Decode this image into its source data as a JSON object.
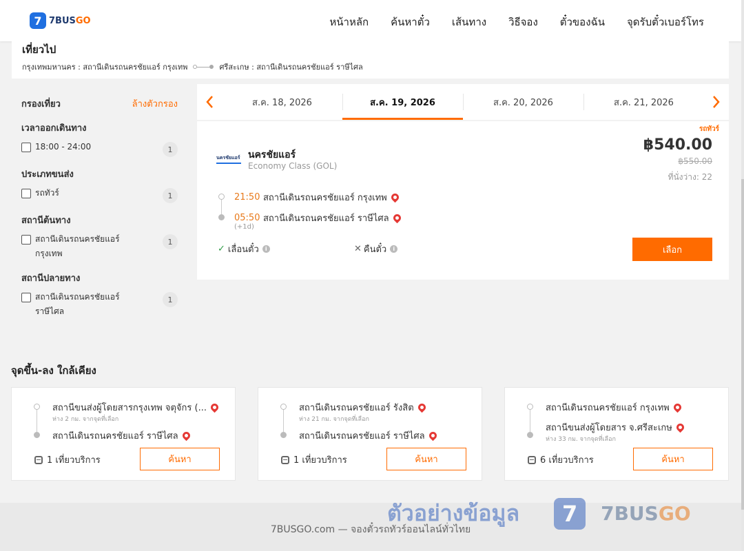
{
  "header": {
    "logo_number": "7",
    "logo_text_1": "7BUS",
    "logo_text_2": "GO",
    "nav": [
      "หน้าหลัก",
      "ค้นหาตั๋ว",
      "เส้นทาง",
      "วิธีจอง",
      "ตั๋วของฉัน",
      "จุดรับตั๋วเบอร์โทร"
    ]
  },
  "route": {
    "title": "เที่ยวไป",
    "from": "กรุงเทพมหานคร : สถานีเดินรถนครชัยแอร์ กรุงเทพ",
    "to": "ศรีสะเกษ : สถานีเดินรถนครชัยแอร์ ราษีไศล"
  },
  "filter": {
    "title": "กรองเที่ยว",
    "clear": "ล้างตัวกรอง",
    "groups": [
      {
        "title": "เวลาออกเดินทาง",
        "options": [
          {
            "label": "18:00 - 24:00",
            "count": "1"
          }
        ]
      },
      {
        "title": "ประเภทขนส่ง",
        "options": [
          {
            "label": "รถทัวร์",
            "count": "1"
          }
        ]
      },
      {
        "title": "สถานีต้นทาง",
        "options": [
          {
            "label": "สถานีเดินรถนครชัยแอร์ กรุงเทพ",
            "count": "1"
          }
        ]
      },
      {
        "title": "สถานีปลายทาง",
        "options": [
          {
            "label": "สถานีเดินรถนครชัยแอร์ ราษีไศล",
            "count": "1"
          }
        ]
      }
    ]
  },
  "dates": {
    "prev_arrow": "‹",
    "next_arrow": "›",
    "tabs": [
      "ส.ค. 18, 2026",
      "ส.ค. 19, 2026",
      "ส.ค. 20, 2026",
      "ส.ค. 21, 2026"
    ],
    "active_index": 1
  },
  "trip": {
    "tag": "รถทัวร์",
    "operator_logo": "นครชัยแอร์",
    "operator": "นครชัยแอร์",
    "class": "Economy Class (GOL)",
    "price": "฿540.00",
    "old_price": "฿550.00",
    "seats": "ที่นั่งว่าง: 22",
    "depart_time": "21:50",
    "depart_station": "สถานีเดินรถนครชัยแอร์ กรุงเทพ",
    "arrive_time": "05:50",
    "arrive_station": "สถานีเดินรถนครชัยแอร์ ราษีไศล",
    "plus_day": "(+1d)",
    "reschedule": "เลื่อนตั๋ว",
    "refund": "คืนตั๋ว",
    "choose": "เลือก"
  },
  "nearby": {
    "title": "จุดขึ้น-ลง ใกล้เคียง",
    "cards": [
      {
        "from": "สถานีขนส่งผู้โดยสารกรุงเทพ จตุจักร (...",
        "from_note": "ห่าง 2 กม. จากจุดที่เลือก",
        "to": "สถานีเดินรถนครชัยแอร์ ราษีไศล",
        "to_note": "",
        "trips": "1 เที่ยวบริการ",
        "search": "ค้นหา"
      },
      {
        "from": "สถานีเดินรถนครชัยแอร์ รังสิต",
        "from_note": "ห่าง 21 กม. จากจุดที่เลือก",
        "to": "สถานีเดินรถนครชัยแอร์ ราษีไศล",
        "to_note": "",
        "trips": "1 เที่ยวบริการ",
        "search": "ค้นหา"
      },
      {
        "from": "สถานีเดินรถนครชัยแอร์ กรุงเทพ",
        "from_note": "",
        "to": "สถานีขนส่งผู้โดยสาร จ.ศรีสะเกษ",
        "to_note": "ห่าง 33 กม. จากจุดที่เลือก",
        "trips": "6 เที่ยวบริการ",
        "search": "ค้นหา"
      }
    ]
  },
  "footer": {
    "text": "7BUSGO.com — จองตั๋วรถทัวร์ออนไลน์ทั่วไทย"
  },
  "watermark": {
    "text": "ตัวอย่างข้อมูล",
    "badge": "7",
    "logo_1": "7BUS",
    "logo_2": "GO"
  },
  "colors": {
    "accent": "#ff6b00",
    "brand_blue": "#1f6fe0",
    "pin": "#e53935",
    "ok_green": "#2e9b46"
  }
}
